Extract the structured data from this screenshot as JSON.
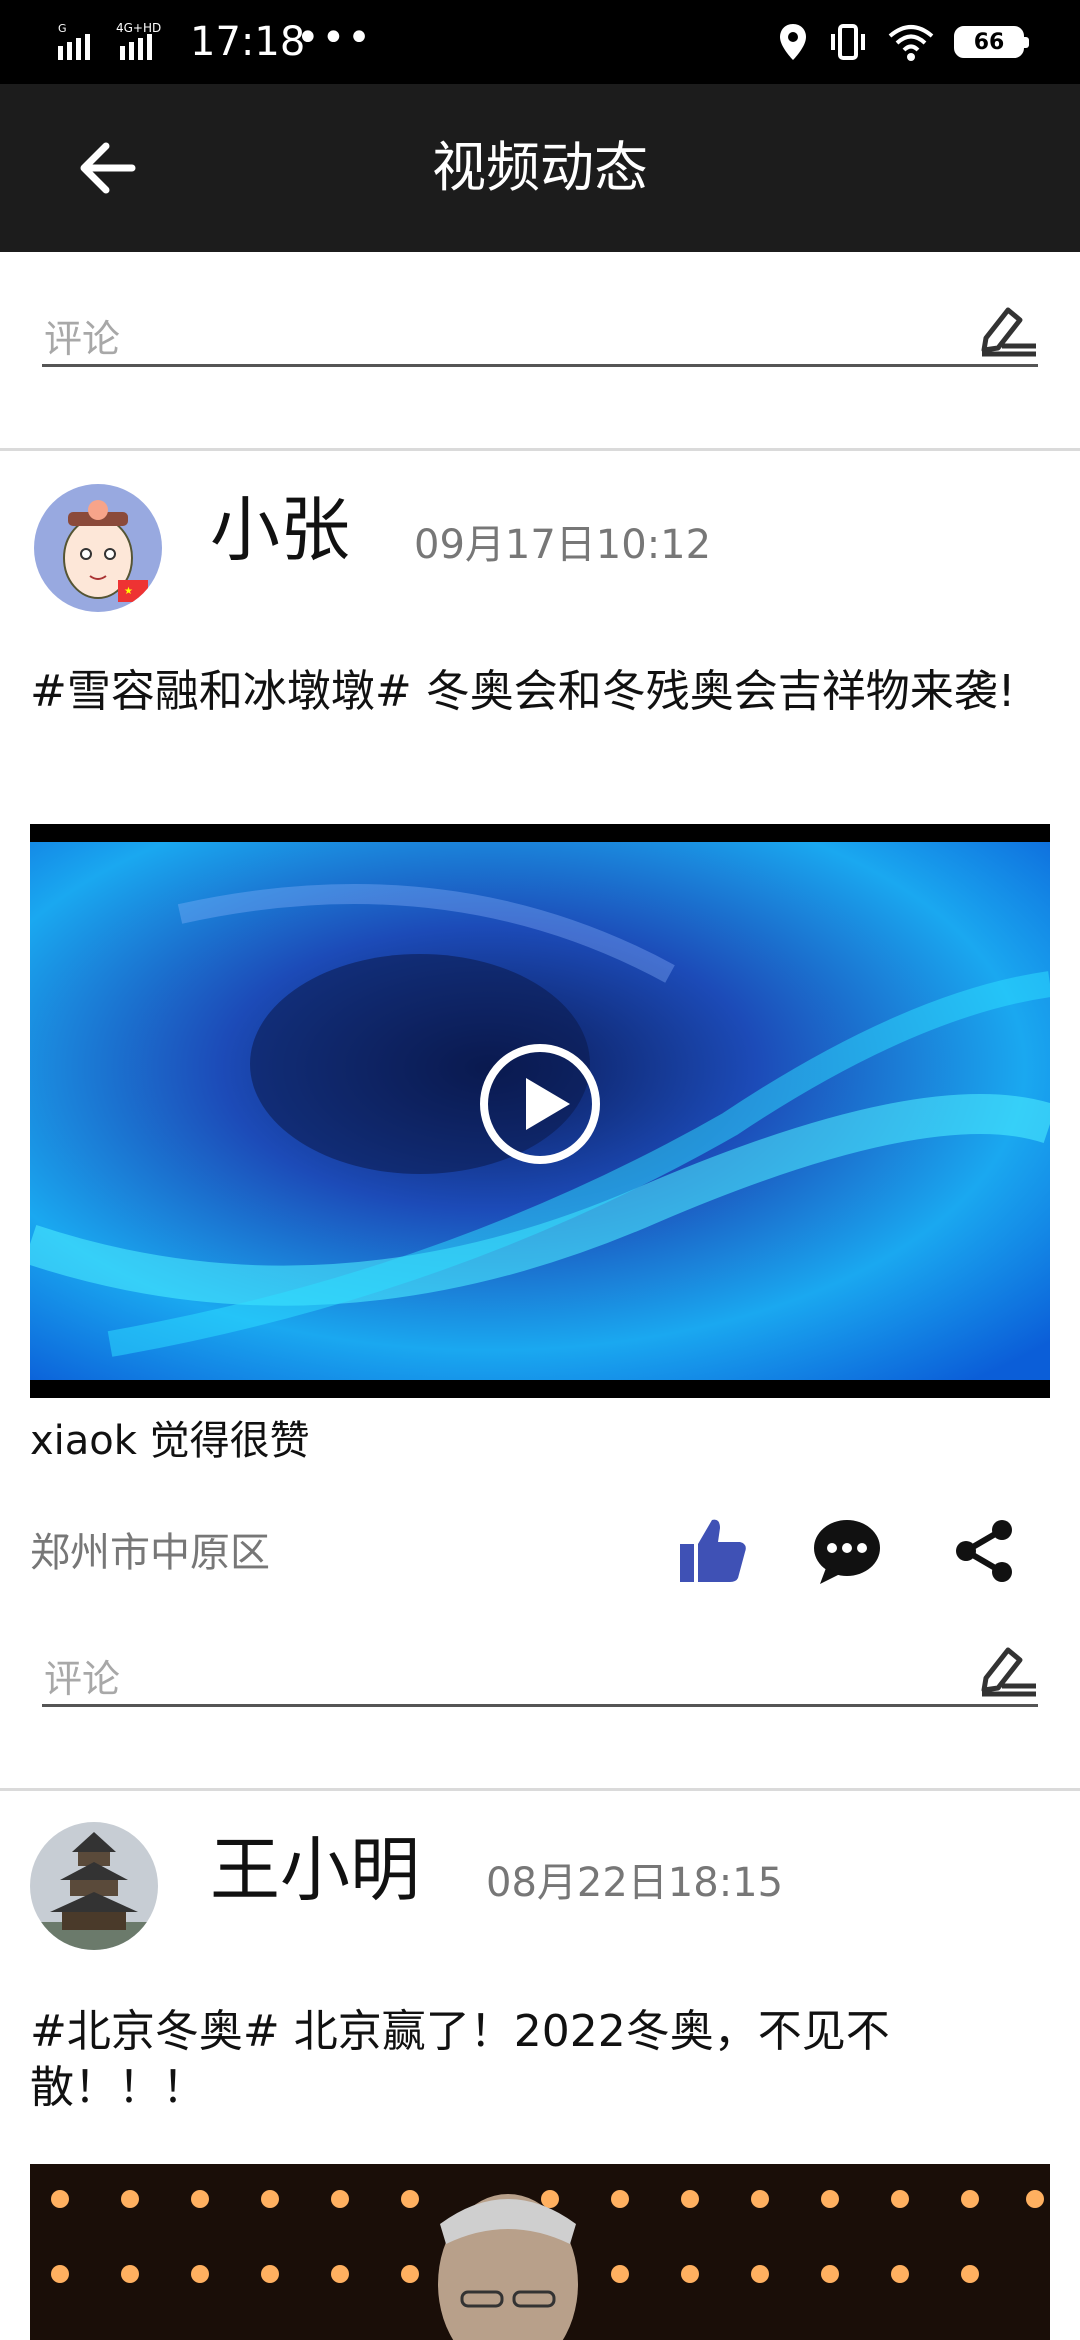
{
  "status_bar": {
    "time": "17:18",
    "more": "•••",
    "battery": "66",
    "network": "4G+HD"
  },
  "app_bar": {
    "title": "视频动态"
  },
  "top_comment": {
    "placeholder": "评论"
  },
  "posts": [
    {
      "username": "小张",
      "time": "09月17日10:12",
      "text": "#雪容融和冰墩墩# 冬奥会和冬残奥会吉祥物来袭!",
      "likes_text": "xiaok 觉得很赞",
      "location": "郑州市中原区",
      "comment_placeholder": "评论"
    },
    {
      "username": "王小明",
      "time": "08月22日18:15",
      "text": "#北京冬奥# 北京赢了！2022冬奥，不见不散！！！"
    }
  ],
  "colors": {
    "like_active": "#3f51b5",
    "app_bar_bg": "#1c1c1c",
    "status_bg": "#000000"
  }
}
